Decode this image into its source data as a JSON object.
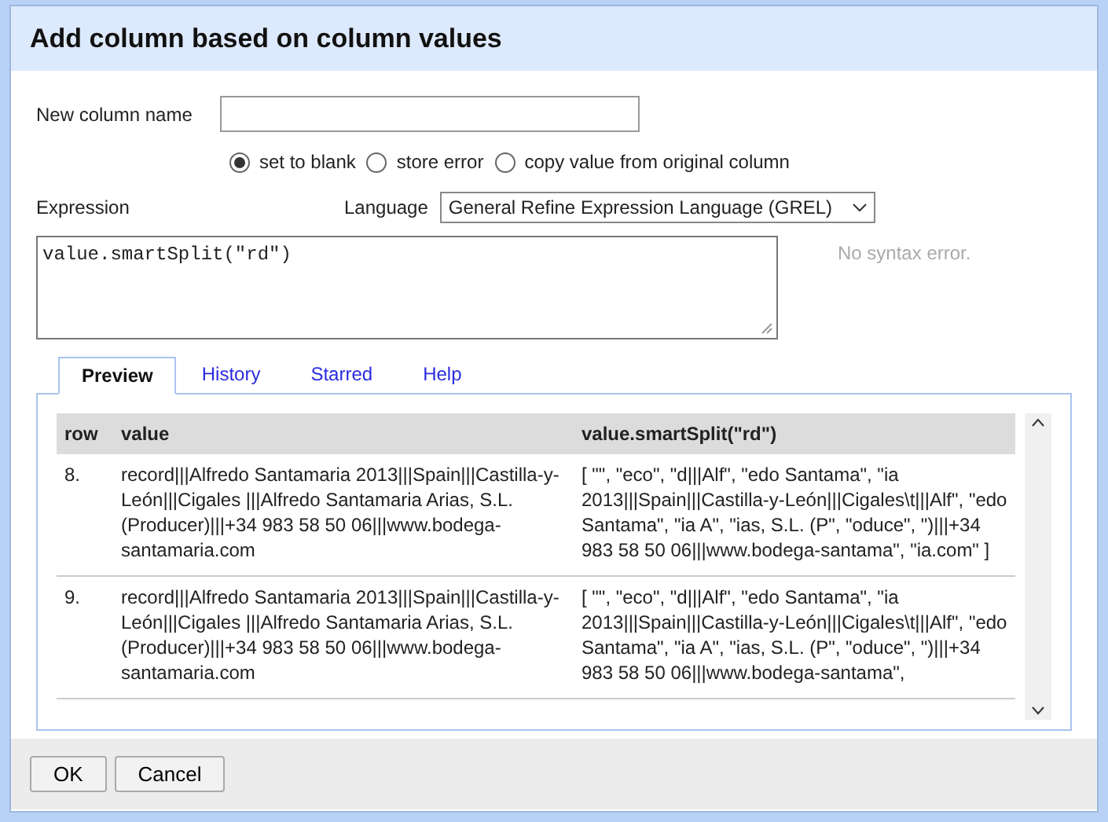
{
  "dialog": {
    "title": "Add column based on column values"
  },
  "new_column": {
    "label": "New column name"
  },
  "on_error": [
    {
      "label": "set to blank",
      "selected": true
    },
    {
      "label": "store error",
      "selected": false
    },
    {
      "label": "copy value from original column",
      "selected": false
    }
  ],
  "expression": {
    "label": "Expression",
    "language_label": "Language",
    "language": "General Refine Expression Language (GREL)",
    "value": "value.smartSplit(\"rd\")",
    "status": "No syntax error."
  },
  "tabs": [
    {
      "label": "Preview",
      "selected": true
    },
    {
      "label": "History",
      "selected": false
    },
    {
      "label": "Starred",
      "selected": false
    },
    {
      "label": "Help",
      "selected": false
    }
  ],
  "preview": {
    "columns": [
      "row",
      "value",
      "value.smartSplit(\"rd\")"
    ],
    "rows": [
      {
        "row": "8.",
        "value": "record|||Alfredo Santamaria 2013|||Spain|||Castilla-y-León|||Cigales |||Alfredo Santamaria Arias, S.L. (Producer)|||+34 983 58 50 06|||www.bodega-santamaria.com",
        "result": "[ \"\", \"eco\", \"d|||Alf\", \"edo Santama\", \"ia 2013|||Spain|||Castilla-y-León|||Cigales\\t|||Alf\", \"edo Santama\", \"ia A\", \"ias, S.L. (P\", \"oduce\", \")|||+34 983 58 50 06|||www.bodega-santama\", \"ia.com\" ]"
      },
      {
        "row": "9.",
        "value": "record|||Alfredo Santamaria 2013|||Spain|||Castilla-y-León|||Cigales |||Alfredo Santamaria Arias, S.L. (Producer)|||+34 983 58 50 06|||www.bodega-santamaria.com",
        "result": "[ \"\", \"eco\", \"d|||Alf\", \"edo Santama\", \"ia 2013|||Spain|||Castilla-y-León|||Cigales\\t|||Alf\", \"edo Santama\", \"ia A\", \"ias, S.L. (P\", \"oduce\", \")|||+34 983 58 50 06|||www.bodega-santama\","
      }
    ]
  },
  "buttons": [
    "OK",
    "Cancel"
  ]
}
